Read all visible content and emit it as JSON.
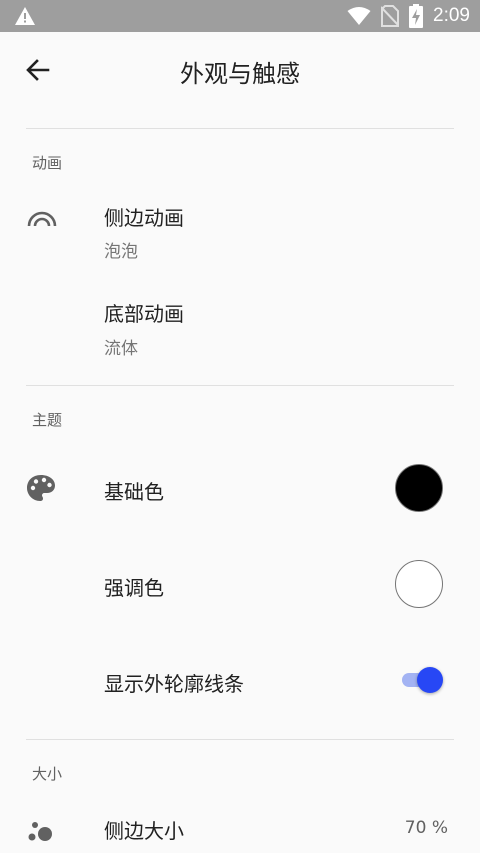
{
  "status_bar": {
    "time": "2:09",
    "icons": [
      "warning-icon",
      "wifi-icon",
      "no-sim-icon",
      "battery-charging-icon"
    ]
  },
  "app_bar": {
    "back_icon": "arrow-back-icon",
    "title": "外观与触感"
  },
  "sections": {
    "animation": {
      "header": "动画",
      "side_animation": {
        "title": "侧边动画",
        "value": "泡泡",
        "icon": "rainbow-arc-icon"
      },
      "bottom_animation": {
        "title": "底部动画",
        "value": "流体"
      }
    },
    "theme": {
      "header": "主题",
      "base_color": {
        "title": "基础色",
        "color": "#000000",
        "icon": "palette-icon"
      },
      "accent_color": {
        "title": "强调色",
        "color": "#ffffff"
      },
      "show_outline": {
        "title": "显示外轮廓线条",
        "enabled": true,
        "accent": "#2747f5"
      }
    },
    "size": {
      "header": "大小",
      "side_size": {
        "title": "侧边大小",
        "value": "70 %",
        "icon": "bubbles-icon"
      }
    }
  }
}
